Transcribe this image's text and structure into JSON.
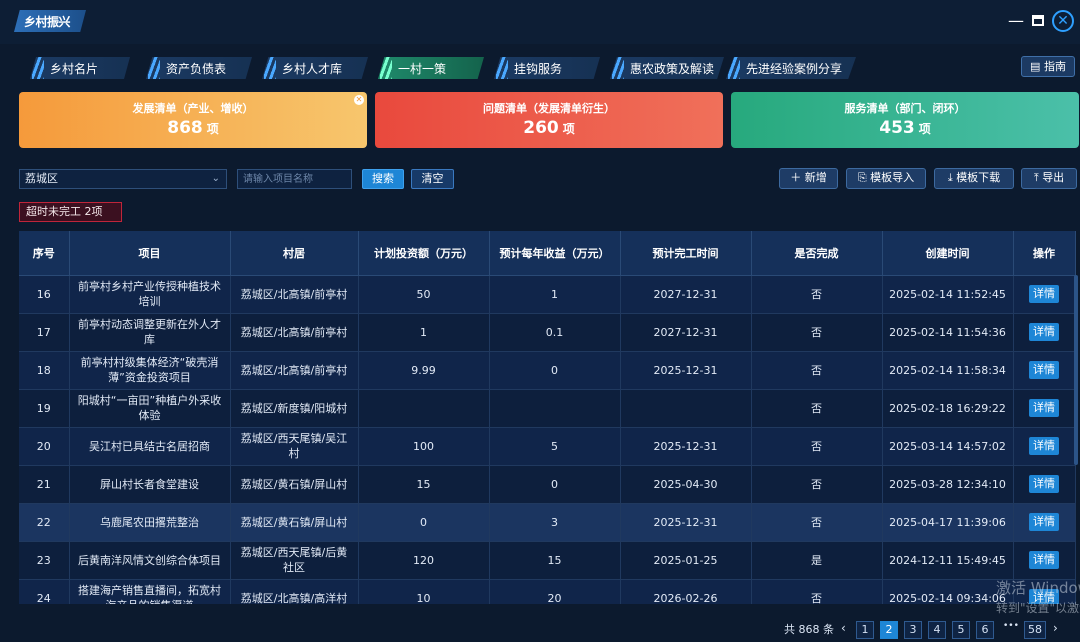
{
  "window": {
    "title": "乡村振兴"
  },
  "nav": {
    "tabs": [
      {
        "label": "乡村名片"
      },
      {
        "label": "资产负债表"
      },
      {
        "label": "乡村人才库"
      },
      {
        "label": "一村一策"
      },
      {
        "label": "挂钩服务"
      },
      {
        "label": "惠农政策及解读"
      },
      {
        "label": "先进经验案例分享"
      }
    ],
    "guide_label": "指南"
  },
  "cards": [
    {
      "title": "发展清单（产业、增收）",
      "value": "868",
      "unit": "项",
      "color": "#f59a3b"
    },
    {
      "title": "问题清单（发展清单衍生）",
      "value": "260",
      "unit": "项",
      "color": "#e9493d"
    },
    {
      "title": "服务清单（部门、闭环）",
      "value": "453",
      "unit": "项",
      "color": "#27a97d"
    }
  ],
  "filters": {
    "district": "荔城区",
    "search_placeholder": "请输入项目名称",
    "search_label": "搜索",
    "clear_label": "清空"
  },
  "toolbar": {
    "add_label": "新增",
    "import_label": "模板导入",
    "download_label": "模板下载",
    "export_label": "导出"
  },
  "overdue": "超时未完工 2项",
  "table": {
    "headers": [
      "序号",
      "项目",
      "村居",
      "计划投资额（万元）",
      "预计每年收益（万元）",
      "预计完工时间",
      "是否完成",
      "创建时间",
      "操作"
    ],
    "rows": [
      {
        "no": "16",
        "project": "前亭村乡村产业传授种植技术培训",
        "village": "荔城区/北高镇/前亭村",
        "invest": "50",
        "income": "1",
        "finish": "2027-12-31",
        "done": "否",
        "created": "2025-02-14 11:52:45",
        "action": "详情"
      },
      {
        "no": "17",
        "project": "前亭村动态调整更新在外人才库",
        "village": "荔城区/北高镇/前亭村",
        "invest": "1",
        "income": "0.1",
        "finish": "2027-12-31",
        "done": "否",
        "created": "2025-02-14 11:54:36",
        "action": "详情"
      },
      {
        "no": "18",
        "project": "前亭村村级集体经济“破壳消薄”资金投资项目",
        "village": "荔城区/北高镇/前亭村",
        "invest": "9.99",
        "income": "0",
        "finish": "2025-12-31",
        "done": "否",
        "created": "2025-02-14 11:58:34",
        "action": "详情"
      },
      {
        "no": "19",
        "project": "阳城村“一亩田”种植户外采收体验",
        "village": "荔城区/新度镇/阳城村",
        "invest": "",
        "income": "",
        "finish": "",
        "done": "否",
        "created": "2025-02-18 16:29:22",
        "action": "详情"
      },
      {
        "no": "20",
        "project": "吴江村已具结古名居招商",
        "village": "荔城区/西天尾镇/吴江村",
        "invest": "100",
        "income": "5",
        "finish": "2025-12-31",
        "done": "否",
        "created": "2025-03-14 14:57:02",
        "action": "详情"
      },
      {
        "no": "21",
        "project": "屏山村长者食堂建设",
        "village": "荔城区/黄石镇/屏山村",
        "invest": "15",
        "income": "0",
        "finish": "2025-04-30",
        "done": "否",
        "created": "2025-03-28 12:34:10",
        "action": "详情"
      },
      {
        "no": "22",
        "project": "乌鹿尾农田撂荒整治",
        "village": "荔城区/黄石镇/屏山村",
        "invest": "0",
        "income": "3",
        "finish": "2025-12-31",
        "done": "否",
        "created": "2025-04-17 11:39:06",
        "action": "详情"
      },
      {
        "no": "23",
        "project": "后黄南洋风情文创综合体项目",
        "village": "荔城区/西天尾镇/后黄社区",
        "invest": "120",
        "income": "15",
        "finish": "2025-01-25",
        "done": "是",
        "created": "2024-12-11 15:49:45",
        "action": "详情"
      },
      {
        "no": "24",
        "project": "搭建海产销售直播间，拓宽村海产品的销售渠道",
        "village": "荔城区/北高镇/高洋村",
        "invest": "10",
        "income": "20",
        "finish": "2026-02-26",
        "done": "否",
        "created": "2025-02-14 09:34:06",
        "action": "详情"
      }
    ]
  },
  "pagination": {
    "total": "共 868 条",
    "pages": [
      "1",
      "2",
      "3",
      "4",
      "5",
      "6",
      "•••",
      "58"
    ],
    "current": "2"
  },
  "os_watermark": {
    "line1": "激活 Windows",
    "line2": "转到\"设置\"以激活"
  }
}
